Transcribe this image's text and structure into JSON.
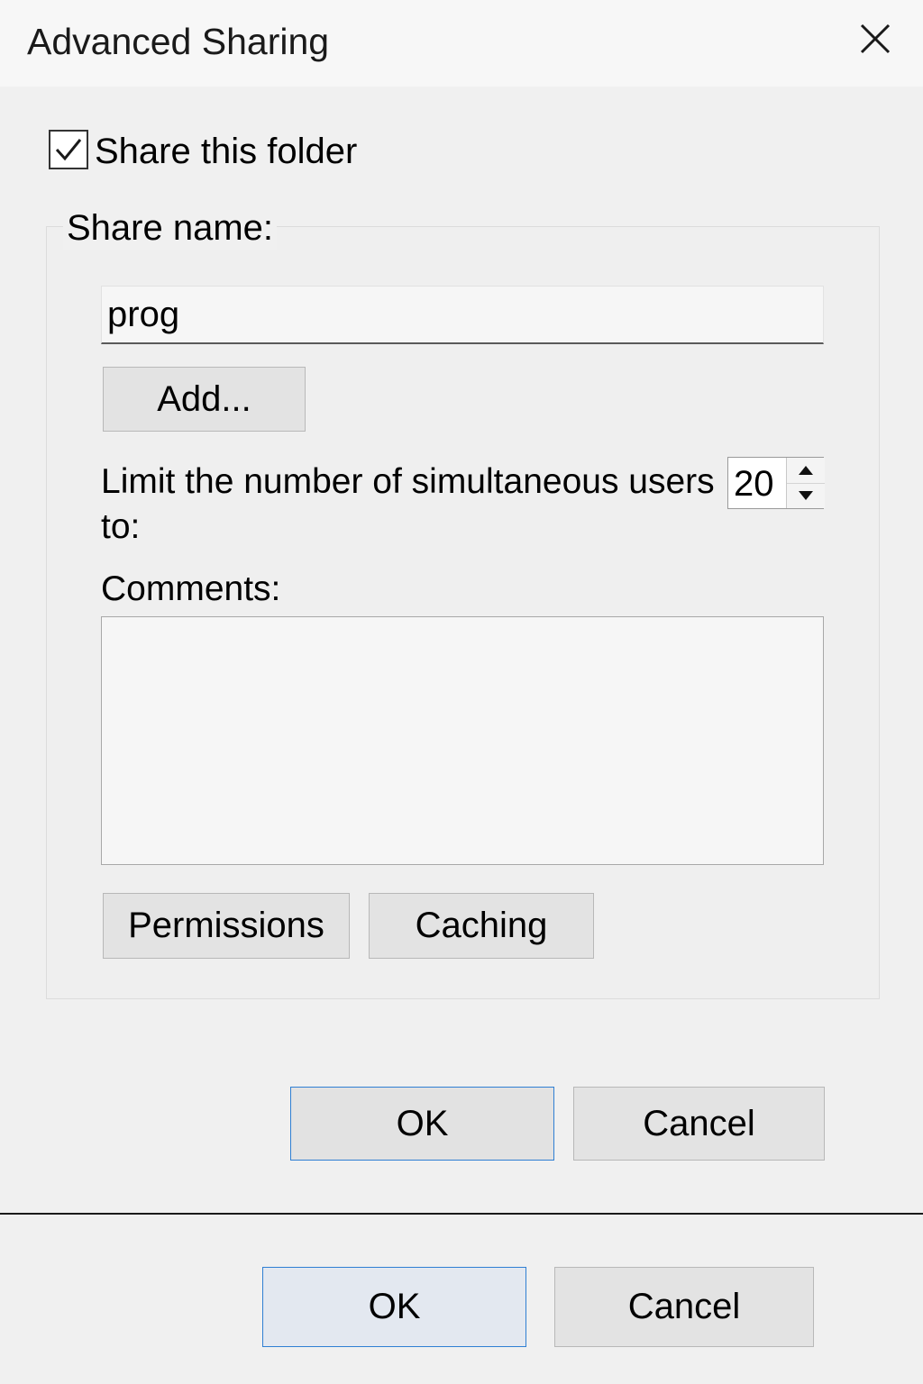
{
  "window": {
    "title": "Advanced Sharing",
    "close_icon": "close-icon"
  },
  "share": {
    "checkbox_label": "Share this folder",
    "checked": true,
    "name_label": "Share name:",
    "name_value": "prog",
    "add_button": "Add...",
    "limit_label": "Limit the number of simultaneous users to:",
    "limit_value": "20",
    "comments_label": "Comments:",
    "comments_value": "",
    "permissions_button": "Permissions",
    "caching_button": "Caching"
  },
  "dialog_buttons": {
    "ok": "OK",
    "cancel": "Cancel"
  },
  "outer_buttons": {
    "ok": "OK",
    "cancel": "Cancel"
  },
  "colors": {
    "background": "#f0f0f0",
    "button_face": "#e3e3e3",
    "default_button_border": "#2f7fd3"
  }
}
